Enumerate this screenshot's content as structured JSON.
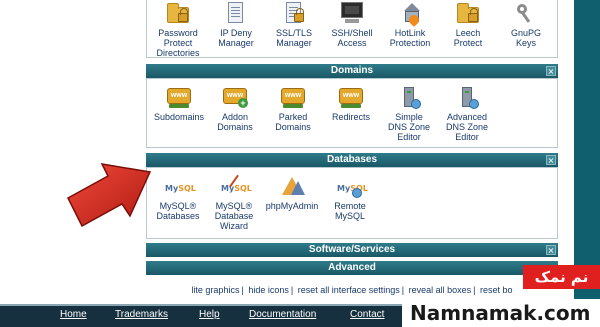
{
  "colors": {
    "header": "#1f6574",
    "right_bar": "#0f5f6e",
    "link": "#1a3a6a",
    "bottom_bar": "#163040",
    "arrow": "#d42a1e",
    "watermark_red": "#e01f1f"
  },
  "security": {
    "items": [
      {
        "label": "Password\nProtect\nDirectories",
        "icon": "folder-lock-icon"
      },
      {
        "label": "IP Deny\nManager",
        "icon": "document-icon"
      },
      {
        "label": "SSL/TLS\nManager",
        "icon": "lock-certificate-icon"
      },
      {
        "label": "SSH/Shell\nAccess",
        "icon": "terminal-monitor-icon"
      },
      {
        "label": "HotLink\nProtection",
        "icon": "house-shield-icon"
      },
      {
        "label": "Leech\nProtect",
        "icon": "folder-lock-icon"
      },
      {
        "label": "GnuPG\nKeys",
        "icon": "key-icon"
      }
    ]
  },
  "domains": {
    "title": "Domains",
    "items": [
      {
        "label": "Subdomains",
        "icon": "www-subdomains-icon"
      },
      {
        "label": "Addon\nDomains",
        "icon": "www-addon-icon"
      },
      {
        "label": "Parked\nDomains",
        "icon": "www-parked-icon"
      },
      {
        "label": "Redirects",
        "icon": "www-redirect-icon"
      },
      {
        "label": "Simple\nDNS Zone\nEditor",
        "icon": "dns-tower-icon"
      },
      {
        "label": "Advanced\nDNS Zone\nEditor",
        "icon": "dns-tower-advanced-icon"
      }
    ]
  },
  "databases": {
    "title": "Databases",
    "items": [
      {
        "label": "MySQL®\nDatabases",
        "icon": "mysql-icon"
      },
      {
        "label": "MySQL®\nDatabase\nWizard",
        "icon": "mysql-wizard-icon"
      },
      {
        "label": "phpMyAdmin",
        "icon": "phpmyadmin-icon"
      },
      {
        "label": "Remote\nMySQL",
        "icon": "remote-mysql-icon"
      }
    ]
  },
  "software": {
    "title": "Software/Services"
  },
  "advanced": {
    "title": "Advanced"
  },
  "footer_links": [
    "lite graphics",
    "hide icons",
    "reset all interface settings",
    "reveal all boxes",
    "reset bo"
  ],
  "bottom_nav": [
    "Home",
    "Trademarks",
    "Help",
    "Documentation",
    "Contact"
  ],
  "watermark": {
    "badge": "نم نمک",
    "site": "Namnamak.com"
  }
}
